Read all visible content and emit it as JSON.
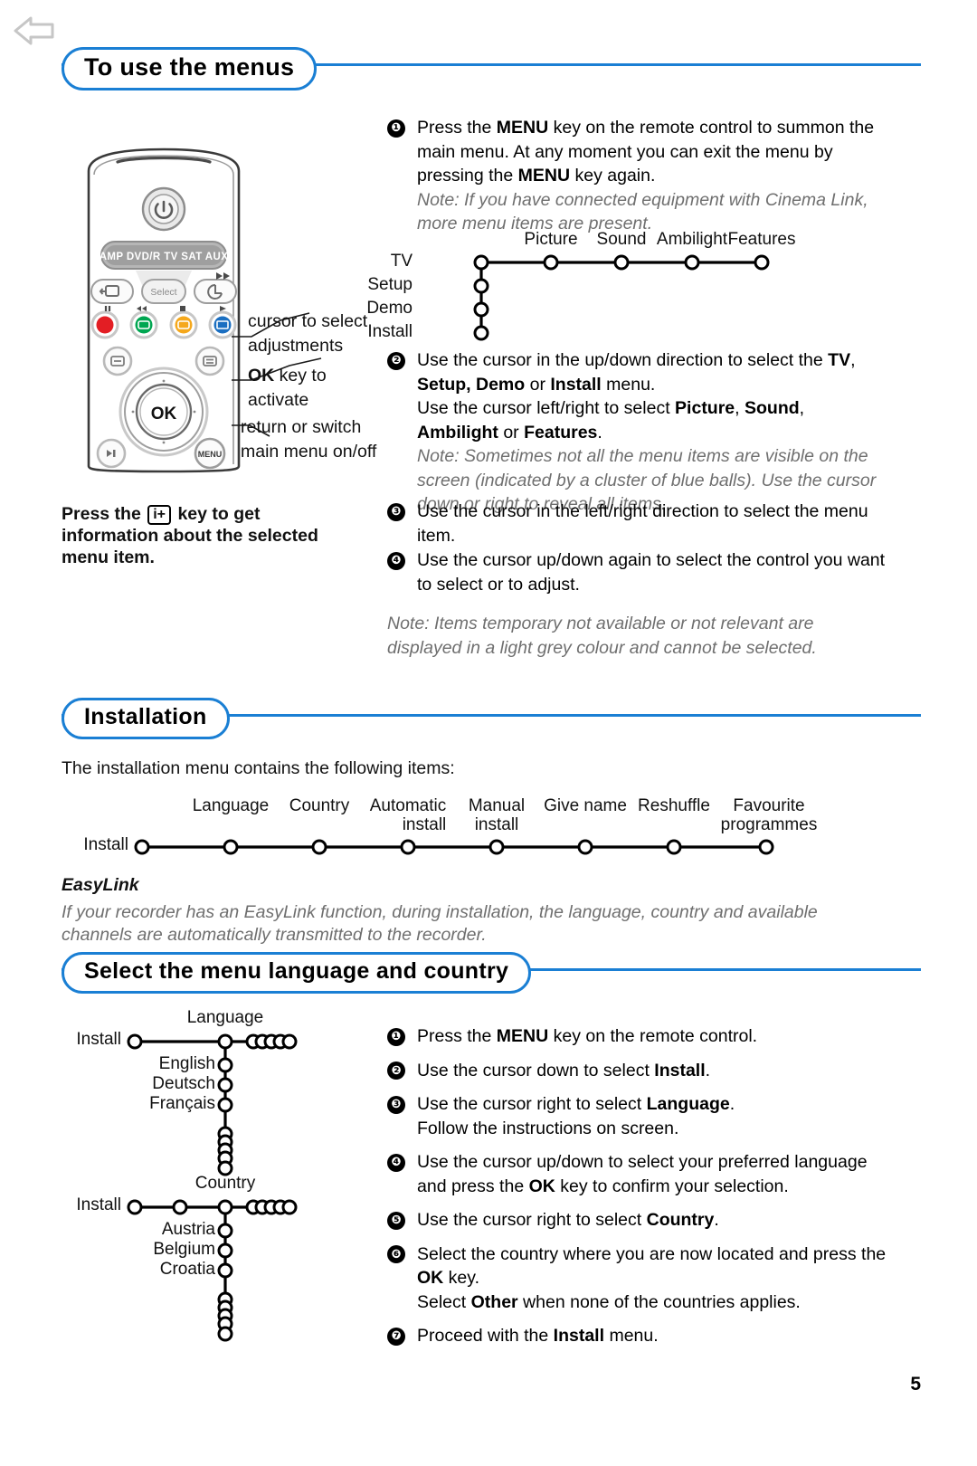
{
  "page": {
    "number": "5",
    "back_icon": "back-arrow-icon",
    "accent_color": "#1a7fd4",
    "note_color": "#6f6f6f"
  },
  "section1": {
    "title": "To use the menus",
    "steps": [
      {
        "num": "❶",
        "lines": [
          "Press the MENU key on the remote control to summon the main menu. At any moment you can exit the menu by pressing the MENU key again."
        ],
        "note": "Note: If you have connected equipment with Cinema Link, more menu items are present."
      },
      {
        "num": "❷",
        "lines": [
          "Use the cursor in the up/down direction to select the TV, Setup, Demo or Install menu.",
          "Use the cursor left/right to select Picture, Sound, Ambilight or Features."
        ],
        "note": "Note: Sometimes not all the menu items are visible on the screen (indicated by a cluster of blue balls). Use the cursor down or right to reveal all items."
      },
      {
        "num": "❸",
        "lines": [
          "Use the cursor in the left/right direction to select the menu item."
        ],
        "note": ""
      },
      {
        "num": "❹",
        "lines": [
          "Use the cursor up/down again to select the control you want to select or to adjust."
        ],
        "note": ""
      }
    ],
    "final_note": "Note: Items temporary not available or not relevant are displayed in a light grey colour and cannot be selected.",
    "menu_tree": {
      "root_items": [
        "TV",
        "Setup",
        "Demo",
        "Install"
      ],
      "branch_items": [
        "Picture",
        "Sound",
        "Ambilight",
        "Features"
      ]
    },
    "remote": {
      "mode_buttons": [
        "AMP",
        "DVD/R",
        "TV",
        "SAT",
        "AUX"
      ],
      "select_label": "Select",
      "ok_label": "OK",
      "menu_label": "MENU",
      "power_icon": "power-icon",
      "colour_buttons": [
        "#e31e24",
        "#00a651",
        "#f5a81c",
        "#1b6fc1"
      ],
      "callouts": [
        "cursor to select adjustments",
        "OK key to activate",
        "return or switch main menu on/off"
      ]
    },
    "info_key_text": {
      "before": "Press the",
      "key": "i+",
      "after": "key to get information about the selected menu item."
    }
  },
  "section2": {
    "title": "Installation",
    "intro": "The installation menu contains the following items:",
    "install_tree": {
      "root": "Install",
      "items": [
        "Language",
        "Country",
        "Automatic\ninstall",
        "Manual\ninstall",
        "Give name",
        "Reshuffle",
        "Favourite\nprogrammes"
      ]
    },
    "easylink_heading": "EasyLink",
    "easylink_body": "If your recorder has an EasyLink function, during installation, the language, country and available channels are automatically transmitted to the recorder."
  },
  "section3": {
    "title": "Select the menu language and country",
    "language_tree": {
      "root": "Install",
      "branch": "Language",
      "items": [
        "English",
        "Deutsch",
        "Français"
      ]
    },
    "country_tree": {
      "root": "Install",
      "branch": "Country",
      "items": [
        "Austria",
        "Belgium",
        "Croatia"
      ]
    },
    "steps": [
      {
        "num": "❶",
        "lines": [
          "Press the MENU key on the remote control."
        ]
      },
      {
        "num": "❷",
        "lines": [
          "Use the cursor down to select Install."
        ]
      },
      {
        "num": "❸",
        "lines": [
          "Use the cursor right to select Language.",
          "Follow the instructions on screen."
        ]
      },
      {
        "num": "❹",
        "lines": [
          "Use the cursor up/down to select your preferred language and press the OK key to confirm your selection."
        ]
      },
      {
        "num": "❺",
        "lines": [
          "Use the cursor right to select Country."
        ]
      },
      {
        "num": "❻",
        "lines": [
          "Select the country where you are now located and press the OK key.",
          "Select Other when none of the countries applies."
        ]
      },
      {
        "num": "❼",
        "lines": [
          "Proceed with the Install menu."
        ]
      }
    ]
  }
}
